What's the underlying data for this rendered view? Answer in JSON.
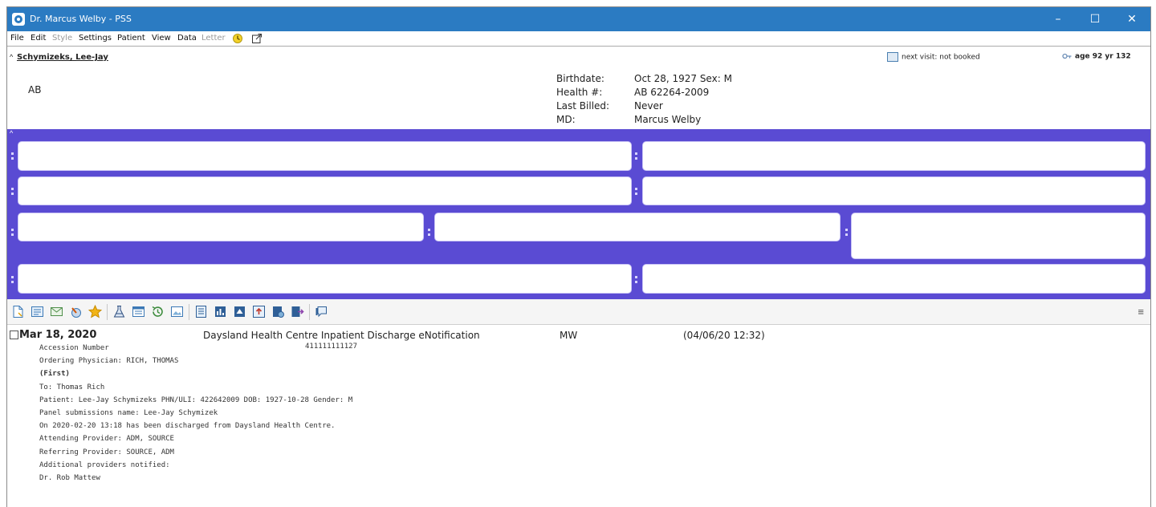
{
  "window": {
    "title": "Dr. Marcus Welby - PSS",
    "controls": {
      "minimize": "–",
      "maximize": "☐",
      "close": "✕"
    }
  },
  "menu": {
    "items": [
      "File",
      "Edit",
      "Style",
      "Settings",
      "Patient",
      "View",
      "Data",
      "Letter"
    ],
    "dimmed": [
      "Style",
      "Letter"
    ]
  },
  "patient": {
    "name": "Schymizeks, Lee-Jay",
    "province": "AB",
    "demographics": {
      "birthdate_label": "Birthdate:",
      "birthdate_value": "Oct 28, 1927   Sex: M",
      "health_label": "Health #:",
      "health_value": "AB 62264-2009",
      "billed_label": "Last Billed:",
      "billed_value": "Never",
      "md_label": "MD:",
      "md_value": "Marcus Welby"
    },
    "next_visit": "next visit:  not booked",
    "age": "age 92 yr   132"
  },
  "toolbar": {
    "icons": [
      "new-document-icon",
      "form-icon",
      "letter-icon",
      "lab-requisition-icon",
      "star-icon",
      "flask-icon",
      "printer-list-icon",
      "history-icon",
      "image-icon",
      "note-icon",
      "chart-view-icon",
      "summary-icon",
      "upload-icon",
      "report-icon",
      "send-icon",
      "comment-icon"
    ],
    "list_icon": "≡"
  },
  "entry": {
    "date": "Mar 18, 2020",
    "title": "Daysland Health Centre  Inpatient Discharge eNotification",
    "md": "MW",
    "timestamp": "(04/06/20 12:32)",
    "accession_number": "411111111127",
    "lines": [
      "Accession Number",
      "Ordering Physician: RICH, THOMAS",
      "(First)",
      "To: Thomas Rich",
      "Patient: Lee-Jay Schymizeks PHN/ULI: 422642009 DOB: 1927-10-28 Gender: M",
      "Panel submissions name: Lee-Jay Schymizek",
      "On 2020-02-20 13:18 has been discharged from Daysland Health Centre.",
      "Attending Provider: ADM, SOURCE",
      "Referring Provider: SOURCE, ADM",
      "Additional providers notified:",
      "Dr. Rob Mattew"
    ]
  },
  "colors": {
    "titlebar": "#2b7bc2",
    "panel_background": "#5a4bd3",
    "panel_card": "#ffffff"
  }
}
